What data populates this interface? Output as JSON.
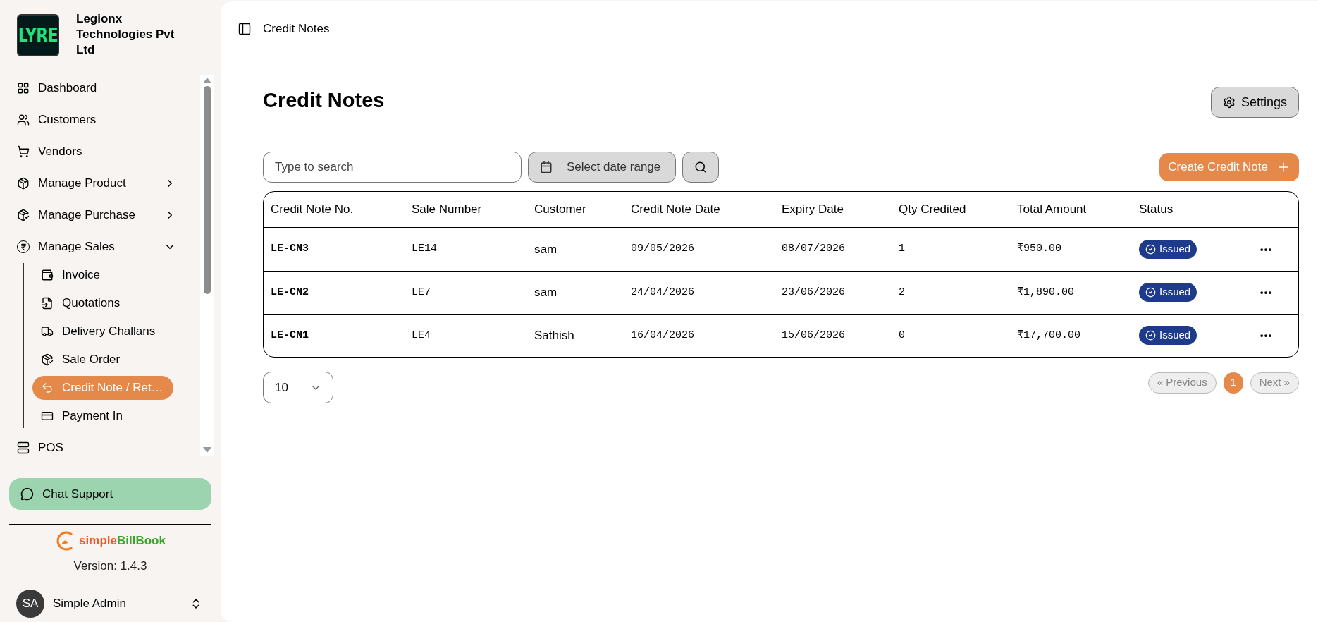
{
  "company": {
    "logo_text": "LYRE",
    "name": "Legionx Technologies Pvt Ltd"
  },
  "sidebar": {
    "items": [
      {
        "label": "Dashboard",
        "kind": "grid",
        "selected": false
      },
      {
        "label": "Customers",
        "kind": "users",
        "selected": false
      },
      {
        "label": "Vendors",
        "kind": "cart",
        "selected": false
      },
      {
        "label": "Manage Product",
        "kind": "box",
        "selected": false,
        "expanded": false
      },
      {
        "label": "Manage Purchase",
        "kind": "boxcheck",
        "selected": false,
        "expanded": false
      },
      {
        "label": "Manage Sales",
        "kind": "rupee",
        "selected": false,
        "expanded": true,
        "children": [
          {
            "label": "Invoice",
            "kind": "wallet",
            "selected": false
          },
          {
            "label": "Quotations",
            "kind": "fileinput",
            "selected": false
          },
          {
            "label": "Delivery Challans",
            "kind": "truck",
            "selected": false
          },
          {
            "label": "Sale Order",
            "kind": "boxcheck",
            "selected": false
          },
          {
            "label": "Credit Note / Ret…",
            "kind": "undo",
            "selected": true
          },
          {
            "label": "Payment In",
            "kind": "card",
            "selected": false
          }
        ]
      },
      {
        "label": "POS",
        "kind": "pos",
        "selected": false
      }
    ],
    "chat_support": "Chat Support",
    "brand": {
      "part_1": "simple",
      "part_2": "BillBook"
    },
    "version": "Version: 1.4.3",
    "user": {
      "initials": "SA",
      "name": "Simple Admin"
    }
  },
  "header": {
    "title": "Credit Notes"
  },
  "page": {
    "title": "Credit Notes",
    "settings_button": "Settings",
    "search": {
      "placeholder": "Type to search"
    },
    "date_range": "Select date range",
    "create_button": "Create Credit Note",
    "table": {
      "columns": [
        "Credit Note No.",
        "Sale Number",
        "Customer",
        "Credit Note Date",
        "Expiry Date",
        "Qty Credited",
        "Total Amount",
        "Status"
      ],
      "rows": [
        {
          "number": "LE-CN3",
          "sale": "LE14",
          "customer": "sam",
          "date": "09/05/2026",
          "expiry": "08/07/2026",
          "qty": "1",
          "amount": "₹950.00",
          "status": "Issued"
        },
        {
          "number": "LE-CN2",
          "sale": "LE7",
          "customer": "sam",
          "date": "24/04/2026",
          "expiry": "23/06/2026",
          "qty": "2",
          "amount": "₹1,890.00",
          "status": "Issued"
        },
        {
          "number": "LE-CN1",
          "sale": "LE4",
          "customer": "Sathish",
          "date": "16/04/2026",
          "expiry": "15/06/2026",
          "qty": "0",
          "amount": "₹17,700.00",
          "status": "Issued"
        }
      ]
    },
    "page_size": "10",
    "pagination": {
      "previous": {
        "label": "« Previous",
        "disabled": true
      },
      "pages": [
        {
          "label": "1",
          "selected": true
        }
      ],
      "next": {
        "label": "Next »",
        "disabled": true
      }
    }
  }
}
